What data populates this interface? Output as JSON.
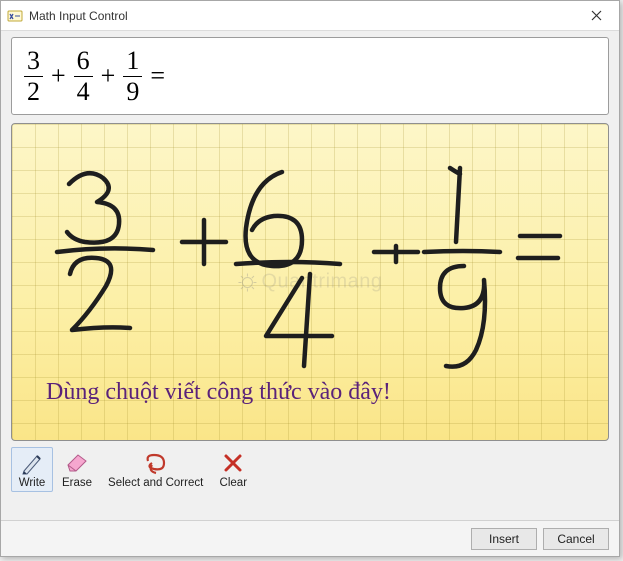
{
  "window": {
    "title": "Math Input Control"
  },
  "output": {
    "f1_num": "3",
    "f1_den": "2",
    "f2_num": "6",
    "f2_den": "4",
    "f3_num": "1",
    "f3_den": "9",
    "plus": "+",
    "equals": "="
  },
  "ink": {
    "caption": "Dùng chuột viết công thức vào đây!",
    "watermark": "Quantrimang"
  },
  "toolbar": {
    "write": "Write",
    "erase": "Erase",
    "select_correct": "Select and Correct",
    "clear": "Clear"
  },
  "footer": {
    "insert": "Insert",
    "cancel": "Cancel"
  },
  "colors": {
    "accent_selected": "#e5edf7",
    "ink_bg_top": "#fdf6c8",
    "ink_bg_bottom": "#fae588",
    "caption_color": "#5a227a"
  }
}
